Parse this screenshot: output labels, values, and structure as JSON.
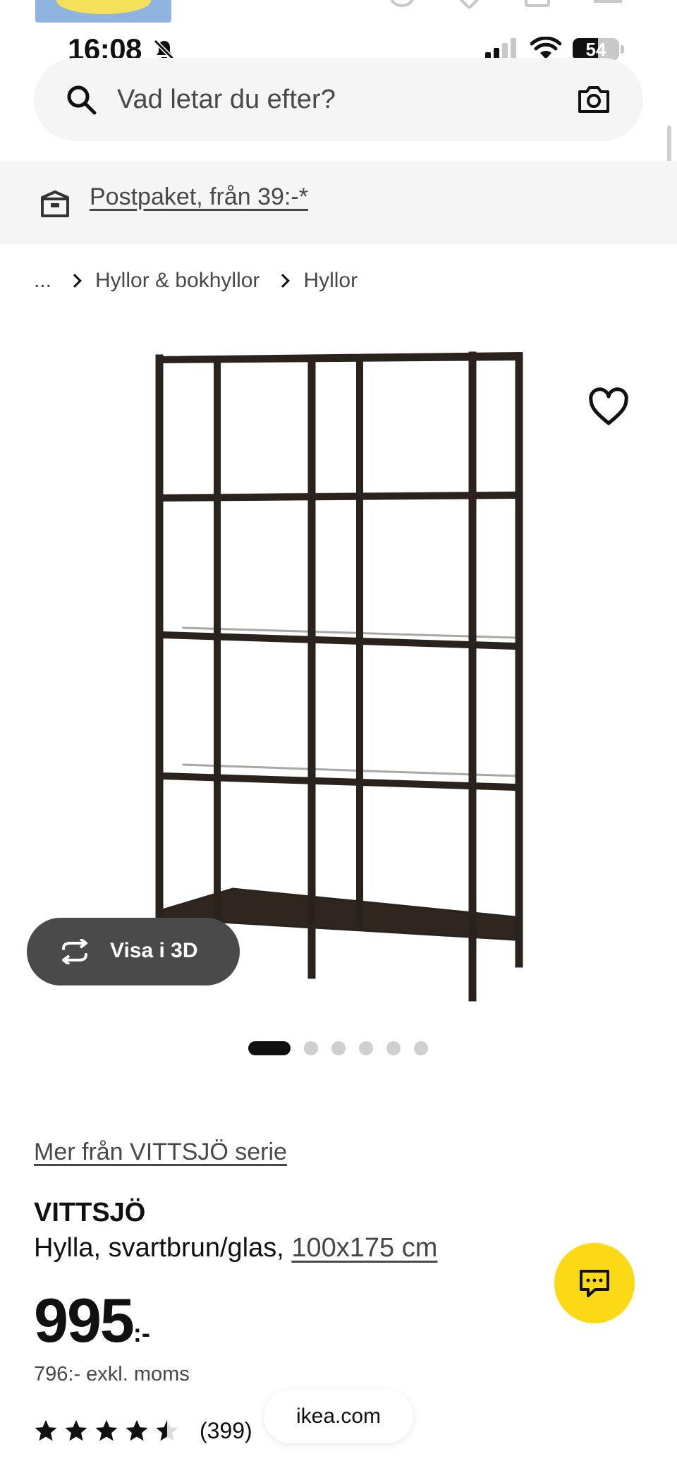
{
  "status_bar": {
    "time": "16:08",
    "battery_level": "54",
    "battery_fraction": 0.54
  },
  "search": {
    "placeholder": "Vad letar du efter?",
    "value": ""
  },
  "delivery": {
    "text": "Postpaket, från 39:-*"
  },
  "breadcrumb": {
    "items": [
      "...",
      "Hyllor & bokhyllor",
      "Hyllor"
    ]
  },
  "gallery": {
    "view_3d_label": "Visa i 3D",
    "dot_count": 6,
    "active_dot": 0
  },
  "product": {
    "series_link": "Mer från VITTSJÖ serie",
    "name": "VITTSJÖ",
    "description": "Hylla, svartbrun/glas, ",
    "size": "100x175 cm",
    "price_main": "995",
    "price_suffix": ":-",
    "price_excl_vat": "796:- exkl. moms",
    "rating_value": 4.5,
    "rating_max": 5,
    "rating_count": "(399)"
  },
  "browser": {
    "domain": "ikea.com"
  },
  "colors": {
    "chat_button": "#fbd914",
    "view_3d_button": "#4a4a4a",
    "banner_bg": "#f5f5f5"
  },
  "icons": {
    "search": "search-icon",
    "camera": "camera-icon",
    "delivery": "box-icon",
    "favorite": "heart-icon",
    "view_3d": "rotate-3d-icon",
    "chat": "chat-icon",
    "star": "star-icon"
  }
}
